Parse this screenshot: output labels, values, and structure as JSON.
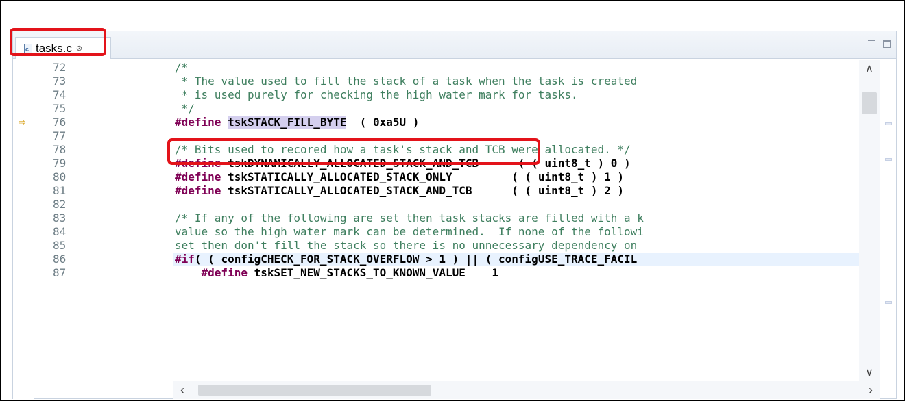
{
  "tab": {
    "label": "tasks.c",
    "close_glyph": "⊘",
    "file_icon": "c-source-file-icon",
    "file_icon_letter": "c"
  },
  "view_controls": {
    "minimize": "minimize-icon",
    "maximize": "maximize-icon"
  },
  "colors": {
    "highlight_border": "#e3131a",
    "comment": "#3f7f5f",
    "keyword": "#7f0055",
    "selection": "#d4cfee",
    "current_line": "#e8f2fe",
    "line_number": "#6d7d85"
  },
  "lines": [
    {
      "num": "72",
      "segments": [
        {
          "t": "/*",
          "c": "cm"
        }
      ]
    },
    {
      "num": "73",
      "segments": [
        {
          "t": " * The value used to fill the stack of a task when the task is created",
          "c": "cm"
        }
      ]
    },
    {
      "num": "74",
      "segments": [
        {
          "t": " * is used purely for checking the high water mark for tasks.",
          "c": "cm"
        }
      ]
    },
    {
      "num": "75",
      "segments": [
        {
          "t": " */",
          "c": "cm"
        }
      ]
    },
    {
      "num": "76",
      "marker": "⇨",
      "segments": [
        {
          "t": "#define",
          "c": "kw"
        },
        {
          "t": " ",
          "c": ""
        },
        {
          "t": "tskSTACK_FILL_BYTE",
          "c": "bold sel"
        },
        {
          "t": "  ( 0xa5U )",
          "c": "bold"
        }
      ]
    },
    {
      "num": "77",
      "segments": []
    },
    {
      "num": "78",
      "segments": [
        {
          "t": "/* Bits used to recored how a task's stack and TCB were allocated. */",
          "c": "cm"
        }
      ]
    },
    {
      "num": "79",
      "segments": [
        {
          "t": "#define",
          "c": "kw"
        },
        {
          "t": " tskDYNAMICALLY_ALLOCATED_STACK_AND_TCB      ( ( uint8_t ) 0 )",
          "c": "bold"
        }
      ]
    },
    {
      "num": "80",
      "segments": [
        {
          "t": "#define",
          "c": "kw"
        },
        {
          "t": " tskSTATICALLY_ALLOCATED_STACK_ONLY         ( ( uint8_t ) 1 )",
          "c": "bold"
        }
      ]
    },
    {
      "num": "81",
      "segments": [
        {
          "t": "#define",
          "c": "kw"
        },
        {
          "t": " tskSTATICALLY_ALLOCATED_STACK_AND_TCB      ( ( uint8_t ) 2 )",
          "c": "bold"
        }
      ]
    },
    {
      "num": "82",
      "segments": []
    },
    {
      "num": "83",
      "segments": [
        {
          "t": "/* If any of the following are set then task stacks are filled with a k",
          "c": "cm"
        }
      ]
    },
    {
      "num": "84",
      "segments": [
        {
          "t": "value so the high water mark can be determined.  If none of the followi",
          "c": "cm"
        }
      ]
    },
    {
      "num": "85",
      "segments": [
        {
          "t": "set then don't fill the stack so there is no unnecessary dependency on ",
          "c": "cm"
        }
      ]
    },
    {
      "num": "86",
      "current": true,
      "segments": [
        {
          "t": "#if",
          "c": "kw"
        },
        {
          "t": "( ( configCHECK_FOR_STACK_OVERFLOW > 1 ) || ( configUSE_TRACE_FACIL",
          "c": "bold"
        }
      ]
    },
    {
      "num": "87",
      "segments": [
        {
          "t": "    ",
          "c": ""
        },
        {
          "t": "#define",
          "c": "kw"
        },
        {
          "t": " tskSET_NEW_STACKS_TO_KNOWN_VALUE    1",
          "c": "bold"
        }
      ]
    }
  ],
  "scrollbars": {
    "up": "∧",
    "down": "∨",
    "left": "‹",
    "right": "›"
  }
}
